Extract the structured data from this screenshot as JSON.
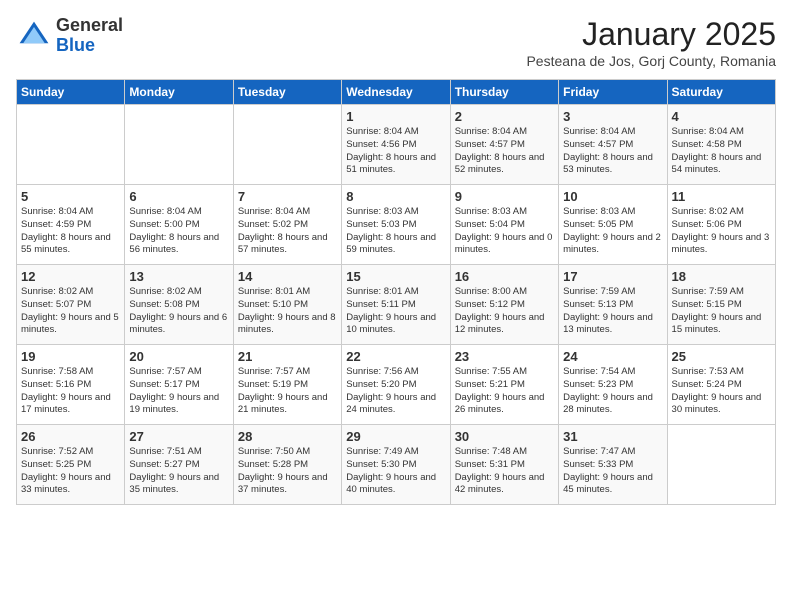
{
  "header": {
    "logo": {
      "general": "General",
      "blue": "Blue"
    },
    "title": "January 2025",
    "subtitle": "Pesteana de Jos, Gorj County, Romania"
  },
  "weekdays": [
    "Sunday",
    "Monday",
    "Tuesday",
    "Wednesday",
    "Thursday",
    "Friday",
    "Saturday"
  ],
  "weeks": [
    [
      {
        "day": null
      },
      {
        "day": null
      },
      {
        "day": null
      },
      {
        "day": "1",
        "info": "Sunrise: 8:04 AM\nSunset: 4:56 PM\nDaylight: 8 hours and 51 minutes."
      },
      {
        "day": "2",
        "info": "Sunrise: 8:04 AM\nSunset: 4:57 PM\nDaylight: 8 hours and 52 minutes."
      },
      {
        "day": "3",
        "info": "Sunrise: 8:04 AM\nSunset: 4:57 PM\nDaylight: 8 hours and 53 minutes."
      },
      {
        "day": "4",
        "info": "Sunrise: 8:04 AM\nSunset: 4:58 PM\nDaylight: 8 hours and 54 minutes."
      }
    ],
    [
      {
        "day": "5",
        "info": "Sunrise: 8:04 AM\nSunset: 4:59 PM\nDaylight: 8 hours and 55 minutes."
      },
      {
        "day": "6",
        "info": "Sunrise: 8:04 AM\nSunset: 5:00 PM\nDaylight: 8 hours and 56 minutes."
      },
      {
        "day": "7",
        "info": "Sunrise: 8:04 AM\nSunset: 5:02 PM\nDaylight: 8 hours and 57 minutes."
      },
      {
        "day": "8",
        "info": "Sunrise: 8:03 AM\nSunset: 5:03 PM\nDaylight: 8 hours and 59 minutes."
      },
      {
        "day": "9",
        "info": "Sunrise: 8:03 AM\nSunset: 5:04 PM\nDaylight: 9 hours and 0 minutes."
      },
      {
        "day": "10",
        "info": "Sunrise: 8:03 AM\nSunset: 5:05 PM\nDaylight: 9 hours and 2 minutes."
      },
      {
        "day": "11",
        "info": "Sunrise: 8:02 AM\nSunset: 5:06 PM\nDaylight: 9 hours and 3 minutes."
      }
    ],
    [
      {
        "day": "12",
        "info": "Sunrise: 8:02 AM\nSunset: 5:07 PM\nDaylight: 9 hours and 5 minutes."
      },
      {
        "day": "13",
        "info": "Sunrise: 8:02 AM\nSunset: 5:08 PM\nDaylight: 9 hours and 6 minutes."
      },
      {
        "day": "14",
        "info": "Sunrise: 8:01 AM\nSunset: 5:10 PM\nDaylight: 9 hours and 8 minutes."
      },
      {
        "day": "15",
        "info": "Sunrise: 8:01 AM\nSunset: 5:11 PM\nDaylight: 9 hours and 10 minutes."
      },
      {
        "day": "16",
        "info": "Sunrise: 8:00 AM\nSunset: 5:12 PM\nDaylight: 9 hours and 12 minutes."
      },
      {
        "day": "17",
        "info": "Sunrise: 7:59 AM\nSunset: 5:13 PM\nDaylight: 9 hours and 13 minutes."
      },
      {
        "day": "18",
        "info": "Sunrise: 7:59 AM\nSunset: 5:15 PM\nDaylight: 9 hours and 15 minutes."
      }
    ],
    [
      {
        "day": "19",
        "info": "Sunrise: 7:58 AM\nSunset: 5:16 PM\nDaylight: 9 hours and 17 minutes."
      },
      {
        "day": "20",
        "info": "Sunrise: 7:57 AM\nSunset: 5:17 PM\nDaylight: 9 hours and 19 minutes."
      },
      {
        "day": "21",
        "info": "Sunrise: 7:57 AM\nSunset: 5:19 PM\nDaylight: 9 hours and 21 minutes."
      },
      {
        "day": "22",
        "info": "Sunrise: 7:56 AM\nSunset: 5:20 PM\nDaylight: 9 hours and 24 minutes."
      },
      {
        "day": "23",
        "info": "Sunrise: 7:55 AM\nSunset: 5:21 PM\nDaylight: 9 hours and 26 minutes."
      },
      {
        "day": "24",
        "info": "Sunrise: 7:54 AM\nSunset: 5:23 PM\nDaylight: 9 hours and 28 minutes."
      },
      {
        "day": "25",
        "info": "Sunrise: 7:53 AM\nSunset: 5:24 PM\nDaylight: 9 hours and 30 minutes."
      }
    ],
    [
      {
        "day": "26",
        "info": "Sunrise: 7:52 AM\nSunset: 5:25 PM\nDaylight: 9 hours and 33 minutes."
      },
      {
        "day": "27",
        "info": "Sunrise: 7:51 AM\nSunset: 5:27 PM\nDaylight: 9 hours and 35 minutes."
      },
      {
        "day": "28",
        "info": "Sunrise: 7:50 AM\nSunset: 5:28 PM\nDaylight: 9 hours and 37 minutes."
      },
      {
        "day": "29",
        "info": "Sunrise: 7:49 AM\nSunset: 5:30 PM\nDaylight: 9 hours and 40 minutes."
      },
      {
        "day": "30",
        "info": "Sunrise: 7:48 AM\nSunset: 5:31 PM\nDaylight: 9 hours and 42 minutes."
      },
      {
        "day": "31",
        "info": "Sunrise: 7:47 AM\nSunset: 5:33 PM\nDaylight: 9 hours and 45 minutes."
      },
      {
        "day": null
      }
    ]
  ]
}
